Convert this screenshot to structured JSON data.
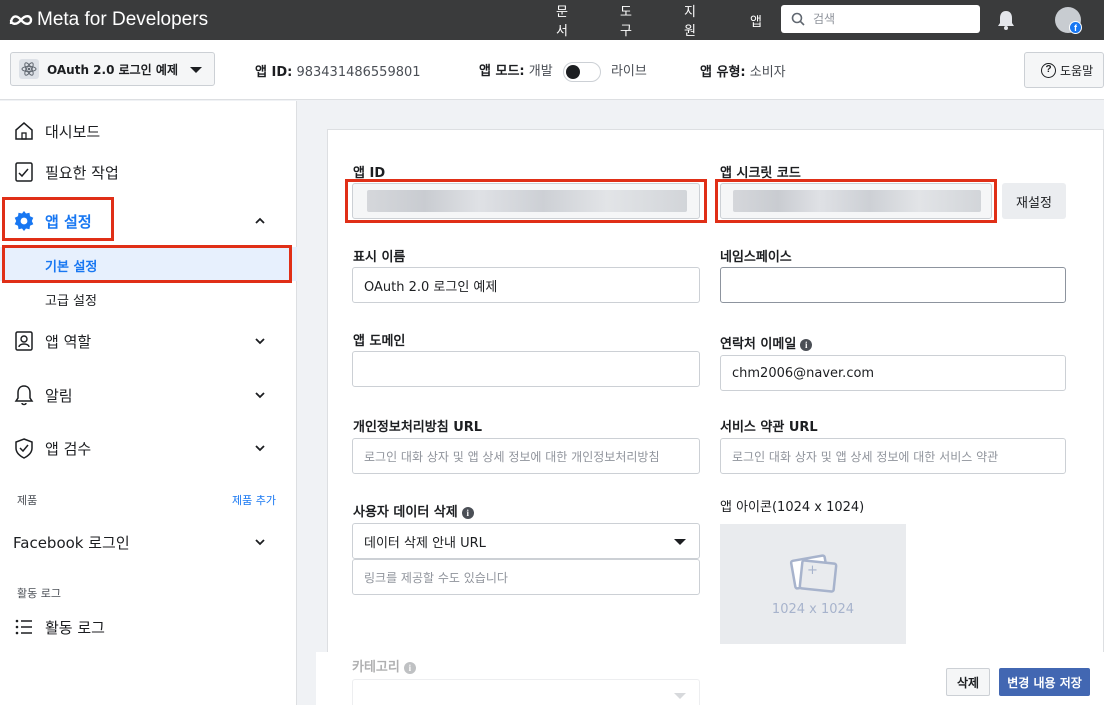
{
  "topbar": {
    "brand": "Meta for Developers",
    "nav": [
      "문서",
      "도구",
      "지원",
      "앱"
    ],
    "search_placeholder": "검색"
  },
  "appbar": {
    "app_name": "OAuth 2.0 로그인 예제",
    "app_id_label": "앱 ID:",
    "app_id_value": "983431486559801",
    "mode_label": "앱 모드:",
    "mode_dev": "개발",
    "mode_live": "라이브",
    "type_label": "앱 유형:",
    "type_value": "소비자",
    "help_label": "도움말"
  },
  "sidebar": {
    "dashboard": "대시보드",
    "required_actions": "필요한 작업",
    "app_settings": "앱 설정",
    "basic_settings": "기본 설정",
    "advanced_settings": "고급 설정",
    "app_roles": "앱 역할",
    "notifications": "알림",
    "app_review": "앱 검수",
    "products_title": "제품",
    "add_product": "제품 추가",
    "facebook_login": "Facebook 로그인",
    "activity_log_title": "활동 로그",
    "activity_log": "활동 로그"
  },
  "form": {
    "app_id_label": "앱 ID",
    "app_secret_label": "앱 시크릿 코드",
    "reset_label": "재설정",
    "display_name_label": "표시 이름",
    "display_name_value": "OAuth 2.0 로그인 예제",
    "namespace_label": "네임스페이스",
    "app_domain_label": "앱 도메인",
    "contact_email_label": "연락처 이메일",
    "contact_email_value": "chm2006@naver.com",
    "privacy_url_label": "개인정보처리방침 URL",
    "privacy_url_placeholder": "로그인 대화 상자 및 앱 상세 정보에 대한 개인정보처리방침",
    "tos_url_label": "서비스 약관 URL",
    "tos_url_placeholder": "로그인 대화 상자 및 앱 상세 정보에 대한 서비스 약관",
    "data_deletion_label": "사용자 데이터 삭제",
    "data_deletion_option": "데이터 삭제 안내 URL",
    "data_deletion_placeholder": "링크를 제공할 수도 있습니다",
    "app_icon_label": "앱 아이콘(1024 x 1024)",
    "app_icon_size": "1024 x 1024",
    "category_label": "카테고리"
  },
  "footer": {
    "delete_label": "삭제",
    "save_label": "변경 내용 저장"
  },
  "colors": {
    "accent": "#1877f2",
    "highlight_box": "#e02f17",
    "save_button": "#4267b2",
    "topbar": "#3a3b3c"
  }
}
